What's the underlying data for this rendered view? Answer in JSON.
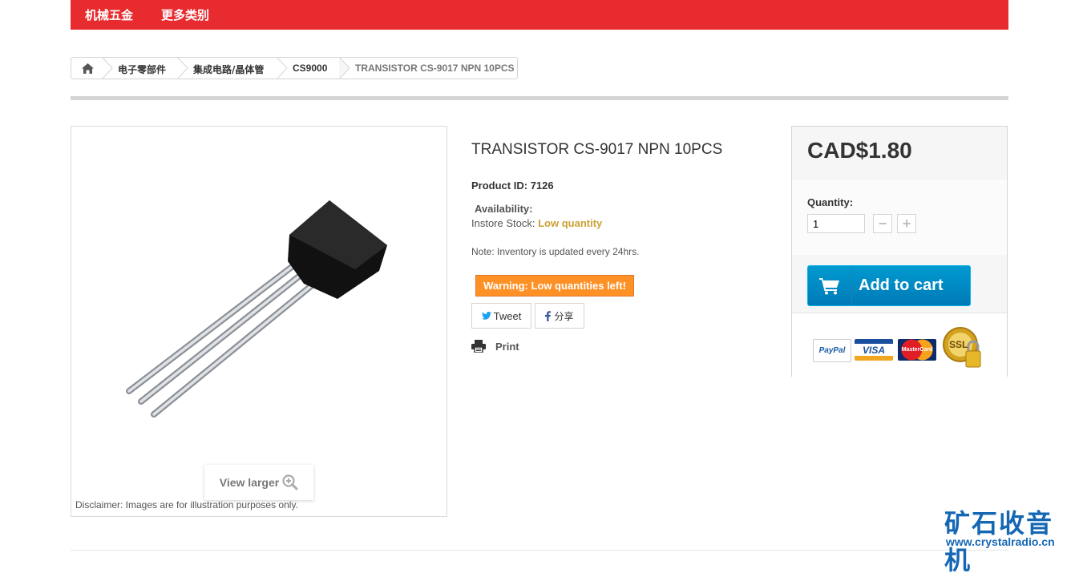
{
  "nav": {
    "items": [
      "机械五金",
      "更多类别"
    ]
  },
  "breadcrumb": {
    "items": [
      "电子零部件",
      "集成电路/晶体管",
      "CS9000"
    ],
    "current": "TRANSISTOR CS-9017 NPN 10PCS"
  },
  "product": {
    "title": "TRANSISTOR CS-9017 NPN 10PCS",
    "id_label": "Product ID:",
    "id_value": "7126",
    "availability_label": "Availability:",
    "stock_label": "Instore Stock:",
    "stock_value": "Low quantity",
    "note": "Note: Inventory is updated every 24hrs.",
    "warning": "Warning: Low quantities left!",
    "tweet": "Tweet",
    "share": "分享",
    "print": "Print",
    "view_larger": "View larger",
    "disclaimer": "Disclaimer: Images are for illustration purposes only."
  },
  "buy": {
    "price": "CAD$1.80",
    "quantity_label": "Quantity:",
    "quantity_value": "1",
    "minus": "−",
    "plus": "+",
    "add_to_cart": "Add to cart",
    "payment_logos": [
      "PayPal",
      "VISA",
      "MasterCard",
      "SSL"
    ]
  },
  "watermark": {
    "text": "矿石收音机",
    "url": "www.crystalradio.cn"
  },
  "colors": {
    "nav_red": "#e72b2e",
    "cart_blue": "#0088c7",
    "warning_orange": "#fe9126",
    "stock_gold": "#c9a136",
    "watermark_blue": "#1567b4"
  }
}
